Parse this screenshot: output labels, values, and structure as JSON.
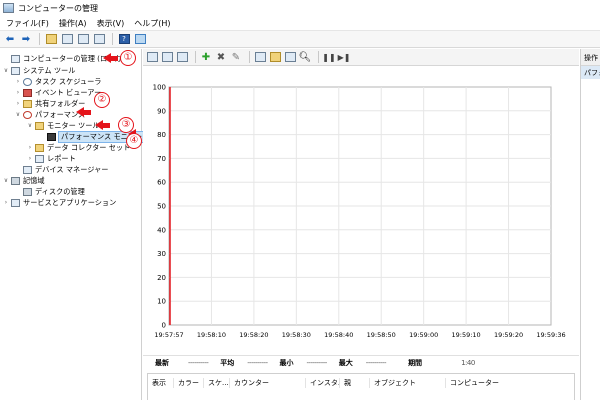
{
  "window": {
    "title": "コンピューターの管理"
  },
  "menu": [
    "ファイル(F)",
    "操作(A)",
    "表示(V)",
    "ヘルプ(H)"
  ],
  "tree": {
    "items": [
      {
        "label": "コンピューターの管理 (ローカル)",
        "icon": "computer-icon"
      },
      {
        "label": "システム ツール",
        "icon": "tools-icon"
      },
      {
        "label": "タスク スケジューラ",
        "icon": "clock-icon"
      },
      {
        "label": "イベント ビューアー",
        "icon": "event-log-icon"
      },
      {
        "label": "共有フォルダー",
        "icon": "shared-folder-icon"
      },
      {
        "label": "パフォーマンス",
        "icon": "performance-icon"
      },
      {
        "label": "モニター ツール",
        "icon": "folder-icon"
      },
      {
        "label": "パフォーマンス モニター",
        "icon": "monitor-icon"
      },
      {
        "label": "データ コレクター セット",
        "icon": "folder-icon"
      },
      {
        "label": "レポート",
        "icon": "report-icon"
      },
      {
        "label": "デバイス マネージャー",
        "icon": "device-manager-icon"
      },
      {
        "label": "記憶域",
        "icon": "storage-icon"
      },
      {
        "label": "ディスクの管理",
        "icon": "disk-icon"
      },
      {
        "label": "サービスとアプリケーション",
        "icon": "services-icon"
      }
    ]
  },
  "markers": [
    "①",
    "②",
    "③",
    "④"
  ],
  "chart_data": {
    "type": "line",
    "title": "",
    "xlabel": "",
    "ylabel": "",
    "ylim": [
      0,
      100
    ],
    "yticks": [
      "100",
      "90",
      "80",
      "70",
      "60",
      "50",
      "40",
      "30",
      "20",
      "10",
      "0"
    ],
    "xticks": [
      "19:57:57",
      "19:58:10",
      "19:58:20",
      "19:58:30",
      "19:58:40",
      "19:58:50",
      "19:59:00",
      "19:59:10",
      "19:59:20",
      "19:59:36"
    ],
    "series": [],
    "grid": true,
    "colors": {
      "time_bar": "#e4141b",
      "grid": "#e6e6e6"
    }
  },
  "stats": {
    "latest_label": "最新",
    "latest_value": "----------",
    "average_label": "平均",
    "average_value": "----------",
    "min_label": "最小",
    "min_value": "----------",
    "max_label": "最大",
    "max_value": "----------",
    "duration_label": "期間",
    "duration_value": "1:40"
  },
  "counter_columns": [
    "表示",
    "カラー",
    "スケ...",
    "カウンター",
    "インスタ...",
    "親",
    "オブジェクト",
    "コンピューター"
  ],
  "actions": {
    "header": "操作",
    "selected": "パフォーマンス モニター"
  }
}
